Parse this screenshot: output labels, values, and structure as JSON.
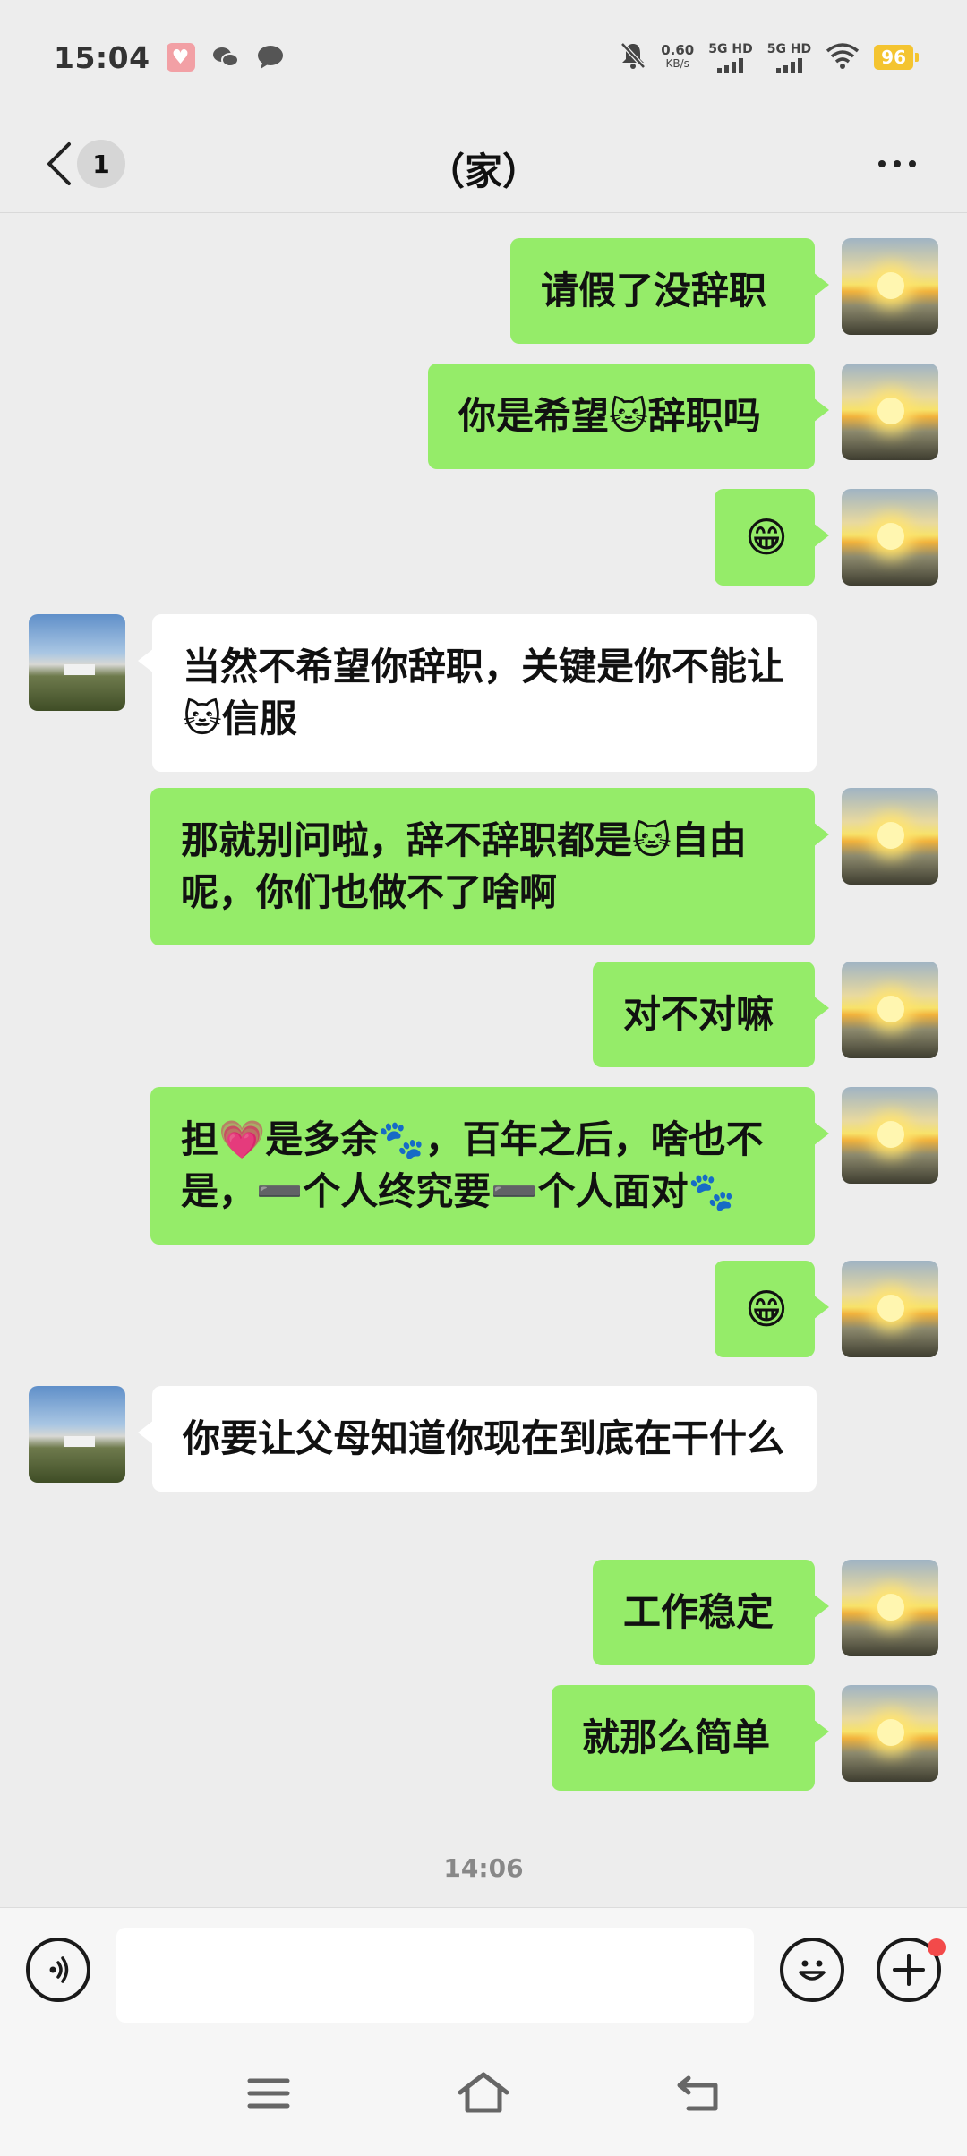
{
  "status_bar": {
    "time": "15:04",
    "net_speed_value": "0.60",
    "net_speed_unit": "KB/s",
    "sim1_label": "5G HD",
    "sim2_label": "5G HD",
    "battery": "96",
    "icons": [
      "health-app-icon",
      "wechat-icon",
      "message-icon",
      "mute-bell-icon",
      "wifi-icon",
      "battery-icon"
    ],
    "battery_color": "#f4c430"
  },
  "header": {
    "back_icon": "chevron-left-icon",
    "unread_count": "1",
    "title": "（家）",
    "more_icon": "ellipsis-icon"
  },
  "messages": [
    {
      "sender": "me",
      "text": "请假了没辞职"
    },
    {
      "sender": "me",
      "text": "你是希望🐱辞职吗"
    },
    {
      "sender": "me",
      "text": "😁"
    },
    {
      "sender": "other",
      "text": "当然不希望你辞职，关键是你不能让🐱信服"
    },
    {
      "sender": "me",
      "text": "那就别问啦，辞不辞职都是🐱自由呢，你们也做不了啥啊"
    },
    {
      "sender": "me",
      "text": "对不对嘛"
    },
    {
      "sender": "me",
      "text": "担💗是多余🐾，百年之后，啥也不是，➖个人终究要➖个人面对🐾"
    },
    {
      "sender": "me",
      "text": "😁"
    },
    {
      "sender": "other",
      "text": "你要让父母知道你现在到底在干什么"
    },
    {
      "sender": "me",
      "text": "工作稳定"
    },
    {
      "sender": "me",
      "text": "就那么简单"
    }
  ],
  "timestamp": "14:06",
  "input_bar": {
    "voice_icon": "voice-icon",
    "input_value": "",
    "emoji_icon": "smiley-icon",
    "plus_icon": "plus-icon"
  },
  "nav_bar": {
    "icons": [
      "menu-icon",
      "home-icon",
      "back-icon"
    ]
  },
  "colors": {
    "my_bubble": "#95ec69",
    "other_bubble": "#ffffff",
    "background": "#ededed"
  }
}
